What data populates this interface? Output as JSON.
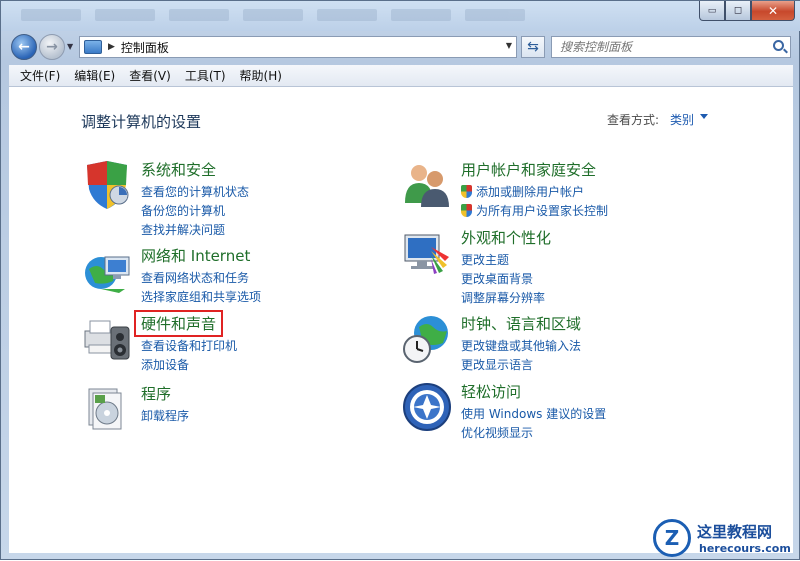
{
  "window": {
    "controls": {
      "minimize": "▭",
      "maximize": "◻",
      "close": "✕"
    }
  },
  "navbar": {
    "address": "控制面板",
    "search_placeholder": "搜索控制面板"
  },
  "menubar": {
    "items": [
      "文件(F)",
      "编辑(E)",
      "查看(V)",
      "工具(T)",
      "帮助(H)"
    ]
  },
  "main": {
    "title": "调整计算机的设置",
    "view_by_label": "查看方式:",
    "view_by_value": "类别",
    "categories": [
      {
        "title": "系统和安全",
        "icon": "shield-icon",
        "links": [
          "查看您的计算机状态",
          "备份您的计算机",
          "查找并解决问题"
        ]
      },
      {
        "title": "网络和 Internet",
        "icon": "network-globe-icon",
        "links": [
          "查看网络状态和任务",
          "选择家庭组和共享选项"
        ]
      },
      {
        "title": "硬件和声音",
        "icon": "printer-speaker-icon",
        "highlighted": true,
        "links": [
          "查看设备和打印机",
          "添加设备"
        ]
      },
      {
        "title": "程序",
        "icon": "programs-icon",
        "links": [
          "卸载程序"
        ]
      },
      {
        "title": "用户帐户和家庭安全",
        "icon": "users-icon",
        "links": [
          "添加或删除用户帐户",
          "为所有用户设置家长控制"
        ]
      },
      {
        "title": "外观和个性化",
        "icon": "monitor-palette-icon",
        "links": [
          "更改主题",
          "更改桌面背景",
          "调整屏幕分辨率"
        ]
      },
      {
        "title": "时钟、语言和区域",
        "icon": "clock-globe-icon",
        "links": [
          "更改键盘或其他输入法",
          "更改显示语言"
        ]
      },
      {
        "title": "轻松访问",
        "icon": "ease-of-access-icon",
        "links": [
          "使用 Windows 建议的设置",
          "优化视频显示"
        ]
      }
    ]
  },
  "watermark": {
    "name": "这里教程网",
    "url": "herecours.com",
    "logo": "Z"
  }
}
